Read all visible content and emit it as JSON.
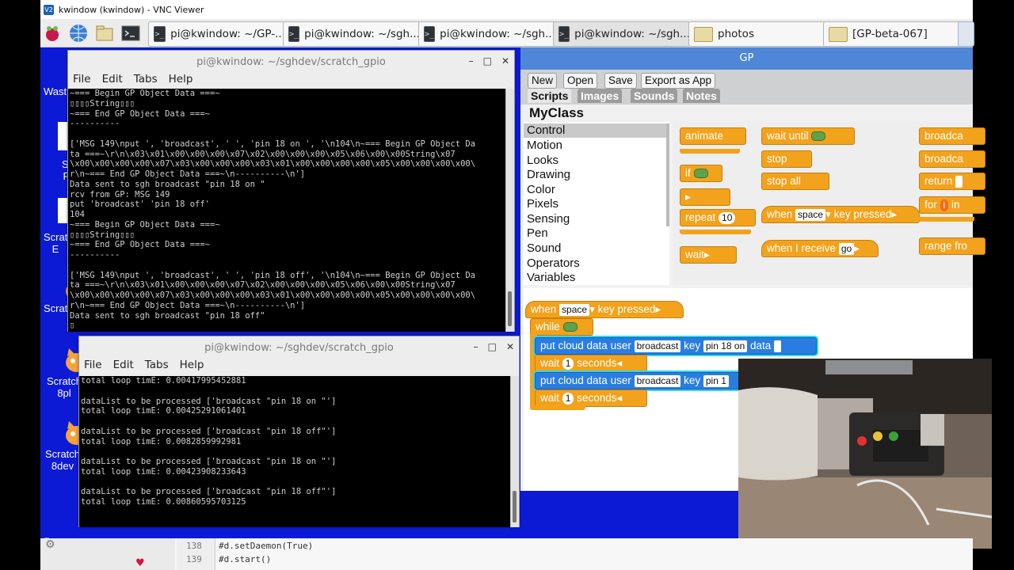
{
  "vnc": {
    "title": "kwindow (kwindow) - VNC Viewer",
    "icon": "V2"
  },
  "taskbar": {
    "tasks": [
      {
        "label": "pi@kwindow: ~/GP-...",
        "icon": "terminal-icon"
      },
      {
        "label": "pi@kwindow: ~/sgh...",
        "icon": "terminal-icon"
      },
      {
        "label": "pi@kwindow: ~/sgh...",
        "icon": "terminal-icon"
      },
      {
        "label": "pi@kwindow: ~/sgh...",
        "icon": "terminal-icon"
      },
      {
        "label": "photos",
        "icon": "folder-icon"
      },
      {
        "label": "[GP-beta-067]",
        "icon": "folder-icon"
      }
    ],
    "term_glyph": ">_"
  },
  "desktop": {
    "labels": [
      "Wast",
      "So Pr",
      "Scrat E",
      "Scrat",
      "Scratch 8pl",
      "Scratch 8dev"
    ]
  },
  "term1": {
    "title": "pi@kwindow: ~/sghdev/scratch_gpio",
    "menu": [
      "File",
      "Edit",
      "Tabs",
      "Help"
    ],
    "lines": [
      "~=== Begin GP Object Data ===~",
      "▯▯▯▯String▯▯▯",
      "~=== End GP Object Data ===~",
      "----------",
      "",
      "['MSG 149\\nput ', 'broadcast', ' ', 'pin 18 on ', '\\n104\\n~=== Begin GP Object Da",
      "ta ===~\\r\\n\\x03\\x01\\x00\\x00\\x00\\x07\\x02\\x00\\x00\\x00\\x05\\x06\\x00\\x00String\\x07",
      "\\x00\\x00\\x00\\x00\\x07\\x03\\x00\\x00\\x00\\x03\\x01\\x00\\x00\\x00\\x00\\x05\\x00\\x00\\x00\\x00\\",
      "r\\n~=== End GP Object Data ===~\\n----------\\n']",
      "Data sent to sgh broadcast \"pin 18 on \"",
      "rcv from GP: MSG 149",
      "put 'broadcast' 'pin 18 off'",
      "104",
      "~=== Begin GP Object Data ===~",
      "▯▯▯▯String▯▯▯",
      "~=== End GP Object Data ===~",
      "----------",
      "",
      "['MSG 149\\nput ', 'broadcast', ' ', 'pin 18 off', '\\n104\\n~=== Begin GP Object Da",
      "ta ===~\\r\\n\\x03\\x01\\x00\\x00\\x00\\x07\\x02\\x00\\x00\\x00\\x05\\x06\\x00\\x00String\\x07",
      "\\x00\\x00\\x00\\x00\\x07\\x03\\x00\\x00\\x00\\x03\\x01\\x00\\x00\\x00\\x00\\x05\\x00\\x00\\x00\\x00\\",
      "r\\n~=== End GP Object Data ===~\\n----------\\n']",
      "Data sent to sgh broadcast \"pin 18 off\"",
      "▯"
    ]
  },
  "term2": {
    "title": "pi@kwindow: ~/sghdev/scratch_gpio",
    "menu": [
      "File",
      "Edit",
      "Tabs",
      "Help"
    ],
    "lines": [
      "total loop timE: 0.00417995452881",
      "",
      "dataList to be processed ['broadcast \"pin 18 on \"']",
      "total loop timE: 0.00425291061401",
      "",
      "dataList to be processed ['broadcast \"pin 18 off\"']",
      "total loop timE: 0.0082859992981",
      "",
      "dataList to be processed ['broadcast \"pin 18 on \"']",
      "total loop timE: 0.00423908233643",
      "",
      "dataList to be processed ['broadcast \"pin 18 off\"']",
      "total loop timE: 0.00860595703125",
      "",
      "",
      "▯"
    ]
  },
  "gp": {
    "title": "GP",
    "buttons": [
      "New",
      "Open",
      "Save",
      "Export as App"
    ],
    "tabs": [
      "Scripts",
      "Images",
      "Sounds",
      "Notes"
    ],
    "class_name": "MyClass",
    "categories": [
      "Control",
      "Motion",
      "Looks",
      "Drawing",
      "Color",
      "Pixels",
      "Sensing",
      "Pen",
      "Sound",
      "Operators",
      "Variables"
    ],
    "palette": {
      "animate": "animate",
      "if": "if",
      "repeat": "repeat",
      "repeat_n": "10",
      "wait": "wait",
      "wait_until": "wait until",
      "stop": "stop",
      "stop_all": "stop all",
      "when": "when",
      "key_pressed": "key pressed",
      "space": "space",
      "when_receive": "when I receive",
      "go": "go",
      "broadcast": "broadca",
      "return": "return",
      "for": "for",
      "for_i": "i",
      "for_in": "in",
      "range": "range fro"
    },
    "script": {
      "when": "when",
      "space": "space",
      "key_pressed": "key pressed",
      "while": "while",
      "put": "put cloud data user",
      "user": "broadcast",
      "key": "key",
      "key1": "pin 18 on",
      "data": "data",
      "wait": "wait",
      "secs": "1",
      "seconds": "seconds",
      "key2": "pin 1"
    }
  },
  "editor": {
    "lines": [
      {
        "num": "138",
        "code": "#d.setDaemon(True)"
      },
      {
        "num": "139",
        "code": "#d.start()"
      }
    ]
  }
}
